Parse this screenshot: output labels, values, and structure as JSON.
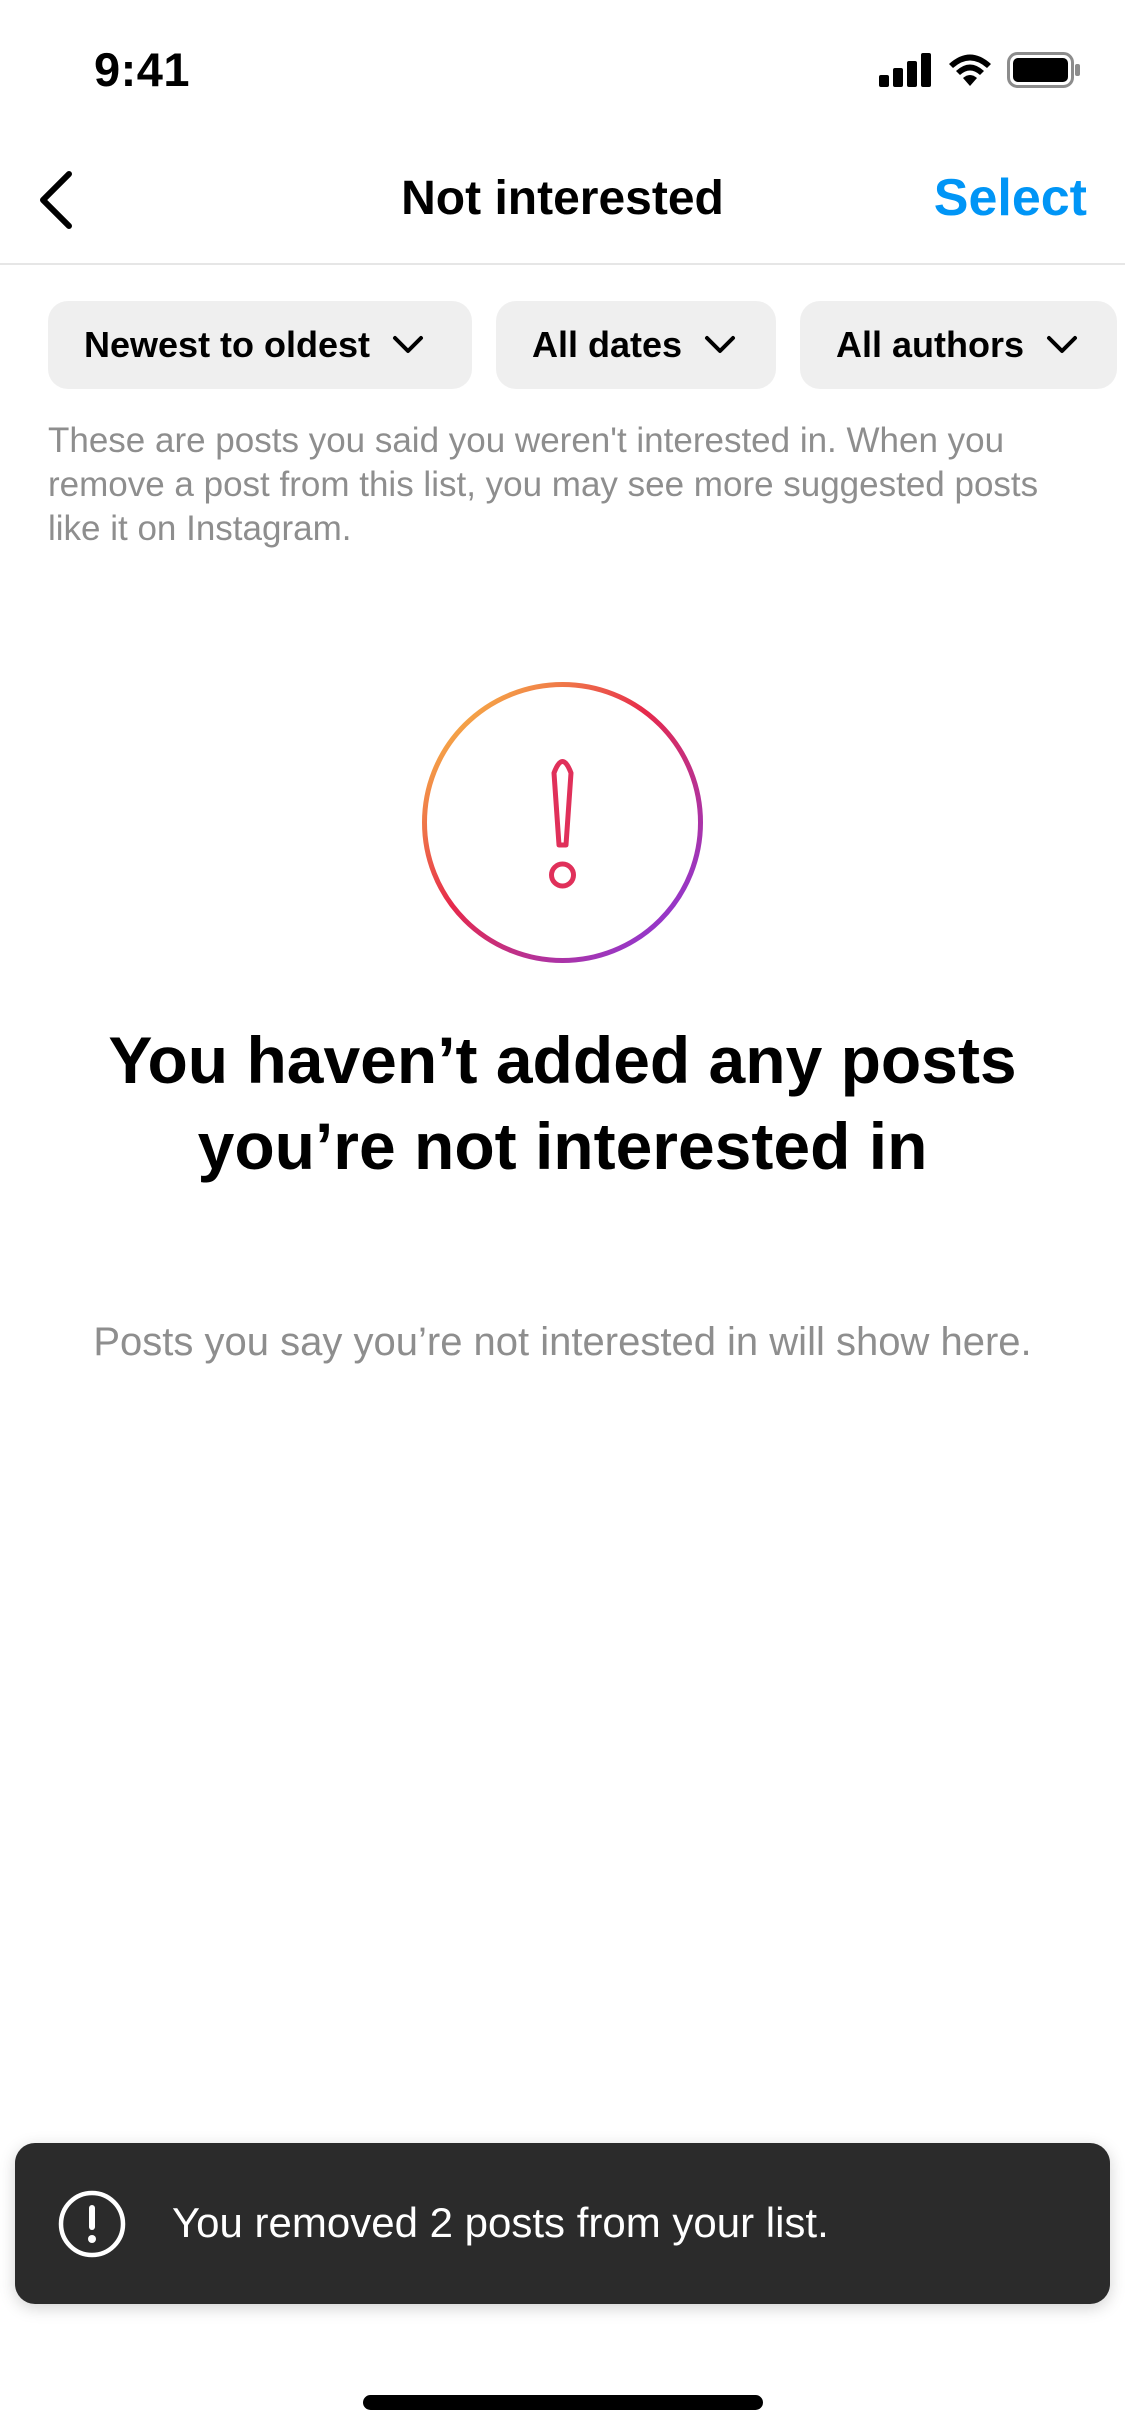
{
  "status_bar": {
    "time": "9:41",
    "icons": [
      "cellular-signal-icon",
      "wifi-icon",
      "battery-icon"
    ]
  },
  "nav": {
    "back_icon": "chevron-left-icon",
    "title": "Not interested",
    "select_label": "Select"
  },
  "filters": [
    {
      "label": "Newest to oldest",
      "icon": "chevron-down-icon"
    },
    {
      "label": "All dates",
      "icon": "chevron-down-icon"
    },
    {
      "label": "All authors",
      "icon": "chevron-down-icon"
    }
  ],
  "description": "These are posts you said you weren't interested in. When you remove a post from this list, you may see more suggested posts like it on Instagram.",
  "empty_state": {
    "icon": "exclamation-circle-icon",
    "title": "You haven’t added any posts you’re not interested in",
    "subtitle": "Posts you say you’re not interested in will show here."
  },
  "toast": {
    "icon": "exclamation-circle-icon",
    "message": "You removed 2 posts from your list."
  },
  "colors": {
    "accent_blue": "#0095f6",
    "gradient": [
      "#fbb945",
      "#e6294b",
      "#7a3cf3"
    ],
    "toast_bg": "#2b2b2b",
    "muted_text": "#8e8e8e"
  }
}
